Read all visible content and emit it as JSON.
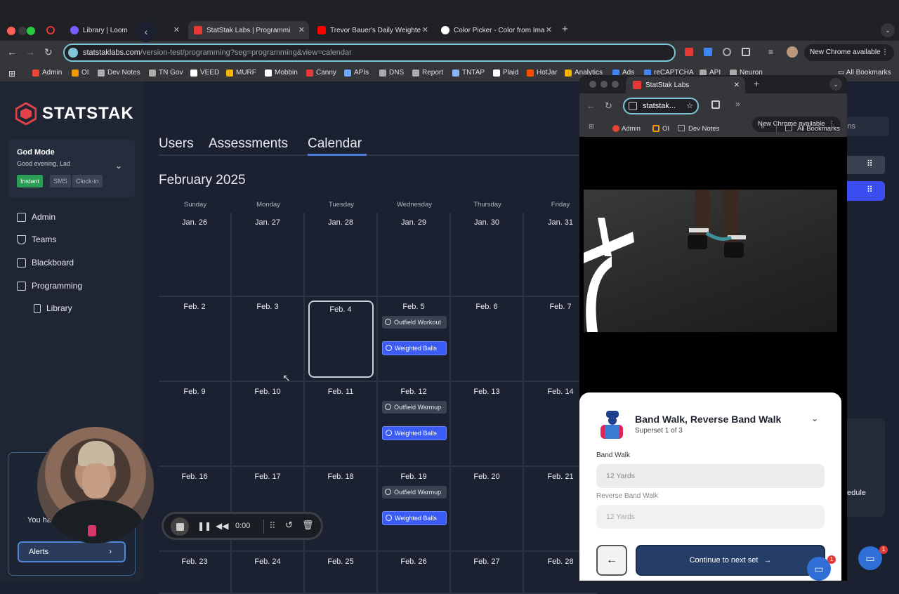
{
  "browser": {
    "tabs": [
      {
        "title": "Library | Loom",
        "color": "#7b5cff"
      },
      {
        "title": "StatStak Labs | Programmi",
        "color": "#e53935"
      },
      {
        "title": "Trevor Bauer's Daily Weighte",
        "color": "#ff0000"
      },
      {
        "title": "Color Picker - Color from Ima",
        "color": "#ffffff"
      }
    ],
    "url_domain": "statstaklabs.com",
    "url_path": "/version-test/programming?seg=programming&view=calendar",
    "new_chrome_label": "New Chrome available",
    "bookmarks": [
      "Admin",
      "OI",
      "Dev Notes",
      "TN Gov",
      "VEED",
      "MURF",
      "Mobbin",
      "Canny",
      "APIs",
      "DNS",
      "Report",
      "TNTAP",
      "Plaid",
      "HotJar",
      "Analytics",
      "Ads",
      "reCAPTCHA",
      "API",
      "Neuron"
    ],
    "all_bookmarks": "All Bookmarks"
  },
  "sidebar": {
    "logo_text": "STATSTAK",
    "user": {
      "mode": "God Mode",
      "greeting": "Good evening, Lad",
      "pills": [
        "Instant",
        "SMS",
        "Clock-in"
      ]
    },
    "nav": [
      {
        "label": "Admin",
        "icon": "briefcase-icon"
      },
      {
        "label": "Teams",
        "icon": "trophy-icon"
      },
      {
        "label": "Blackboard",
        "icon": "monitor-icon"
      },
      {
        "label": "Programming",
        "icon": "clipboard-icon"
      },
      {
        "label": "Library",
        "icon": "book-icon"
      }
    ],
    "alert_text": "You ha",
    "alerts_button": "Alerts"
  },
  "main": {
    "tabs": [
      "Users",
      "Assessments",
      "Calendar"
    ],
    "active_tab": "Calendar",
    "month": "February 2025",
    "weekdays": [
      "Sunday",
      "Monday",
      "Tuesday",
      "Wednesday",
      "Thursday",
      "Friday"
    ],
    "weeks": [
      [
        "Jan. 26",
        "Jan. 27",
        "Jan. 28",
        "Jan. 29",
        "Jan. 30",
        "Jan. 31"
      ],
      [
        "Feb. 2",
        "Feb. 3",
        "Feb. 4",
        "Feb. 5",
        "Feb. 6",
        "Feb. 7"
      ],
      [
        "Feb. 9",
        "Feb. 10",
        "Feb. 11",
        "Feb. 12",
        "Feb. 13",
        "Feb. 14"
      ],
      [
        "Feb. 16",
        "Feb. 17",
        "Feb. 18",
        "Feb. 19",
        "Feb. 20",
        "Feb. 21"
      ],
      [
        "Feb. 23",
        "Feb. 24",
        "Feb. 25",
        "Feb. 26",
        "Feb. 27",
        "Feb. 28"
      ]
    ],
    "events": {
      "w1": [
        {
          "label": "Outfield Workout",
          "kind": "gray"
        },
        {
          "label": "Weighted Balls",
          "kind": "blue"
        }
      ],
      "w2": [
        {
          "label": "Outfield Warmup",
          "kind": "gray"
        },
        {
          "label": "Weighted Balls",
          "kind": "blue"
        }
      ],
      "w3": [
        {
          "label": "Outfield Warmup",
          "kind": "gray"
        },
        {
          "label": "Weighted Balls",
          "kind": "blue"
        }
      ]
    }
  },
  "recorder": {
    "time": "0:00"
  },
  "popup": {
    "tab_title": "StatStak Labs",
    "url": "statstak...",
    "new_chrome": "New Chrome available",
    "bookmarks": [
      "Admin",
      "OI",
      "Dev Notes"
    ],
    "all_bookmarks": "All Bookmarks",
    "exercise_title": "Band Walk, Reverse Band Walk",
    "superset": "Superset 1 of 3",
    "fields": [
      {
        "label": "Band Walk",
        "placeholder": "12 Yards"
      },
      {
        "label": "Reverse Band Walk",
        "placeholder": "12 Yards"
      }
    ],
    "continue_label": "Continue to next set"
  },
  "right_strip": {
    "partial_text_1": "ns",
    "partial_text_2": "edule"
  },
  "badges": {
    "chat_count": "1"
  }
}
